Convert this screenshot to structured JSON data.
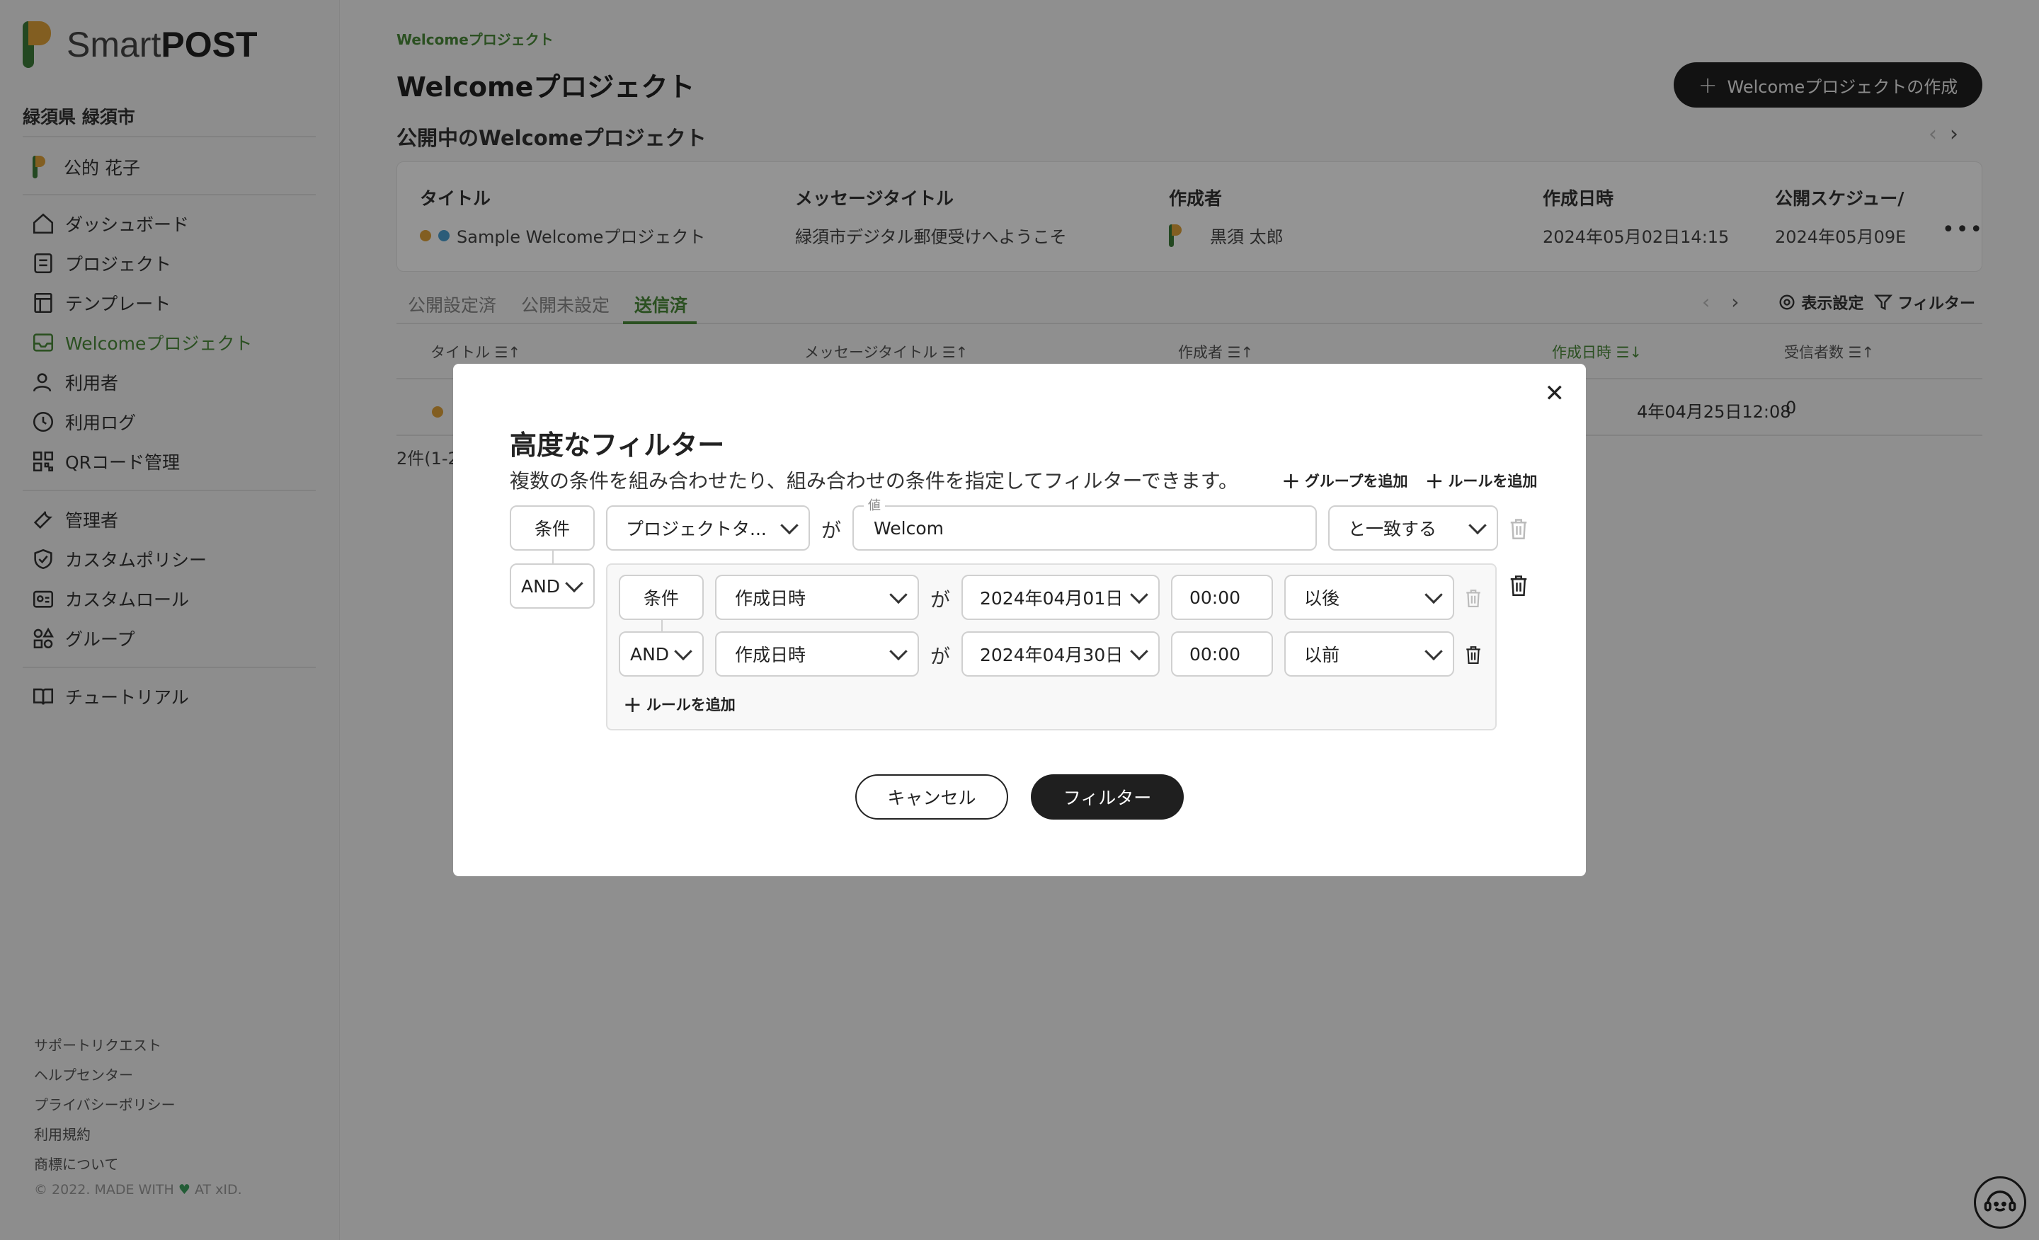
{
  "app": {
    "logo_light": "Smart",
    "logo_bold": "POST",
    "colors": {
      "accent": "#4a8a3a",
      "logo_green": "#3d7d3a",
      "logo_orange": "#e0a23a",
      "dark": "#1f1f1f"
    }
  },
  "sidebar": {
    "org": "緑須県 緑須市",
    "user": "公的 花子",
    "nav": [
      {
        "label": "ダッシュボード",
        "icon": "home-icon"
      },
      {
        "label": "プロジェクト",
        "icon": "project-icon"
      },
      {
        "label": "テンプレート",
        "icon": "template-icon"
      },
      {
        "label": "Welcomeプロジェクト",
        "icon": "welcome-icon",
        "active": true
      },
      {
        "label": "利用者",
        "icon": "user-icon"
      },
      {
        "label": "利用ログ",
        "icon": "log-icon"
      },
      {
        "label": "QRコード管理",
        "icon": "qr-icon"
      },
      {
        "label": "管理者",
        "icon": "admin-icon"
      },
      {
        "label": "カスタムポリシー",
        "icon": "shield-icon"
      },
      {
        "label": "カスタムロール",
        "icon": "role-icon"
      },
      {
        "label": "グループ",
        "icon": "group-icon"
      },
      {
        "label": "チュートリアル",
        "icon": "book-icon"
      }
    ],
    "footer": [
      "サポートリクエスト",
      "ヘルプセンター",
      "プライバシーポリシー",
      "利用規約",
      "商標について"
    ],
    "copyright_pre": "© 2022. MADE WITH",
    "copyright_post": "AT xID."
  },
  "main": {
    "breadcrumb": "Welcomeプロジェクト",
    "title": "Welcomeプロジェクト",
    "create_button": "Welcomeプロジェクトの作成",
    "published_title": "公開中のWelcomeプロジェクト",
    "published_card": {
      "headers": [
        "タイトル",
        "メッセージタイトル",
        "作成者",
        "作成日時",
        "公開スケジュー/"
      ],
      "title": "Sample Welcomeプロジェクト",
      "message_title": "緑須市デジタル郵便受けへようこそ",
      "creator": "黒須 太郎",
      "created_at": "2024年05月02日14:15",
      "schedule": "2024年05月09E"
    },
    "tabs": [
      "公開設定済",
      "公開未設定",
      "送信済"
    ],
    "active_tab": "送信済",
    "tools": {
      "display_settings": "表示設定",
      "filter": "フィルター"
    },
    "table_headers": [
      "タイトル",
      "メッセージタイトル",
      "作成者",
      "作成日時",
      "受信者数"
    ],
    "table_row": {
      "created_at": "4年04月25日12:08",
      "recipients": "0"
    },
    "count_text": "2件(1-2"
  },
  "modal": {
    "title": "高度なフィルター",
    "description": "複数の条件を組み合わせたり、組み合わせの条件を指定してフィルターできます。",
    "add_group": "グループを追加",
    "add_rule": "ルールを追加",
    "condition_label": "条件",
    "ga": "が",
    "rule1": {
      "field": "プロジェクトタ...",
      "value_label": "値",
      "value": "Welcom",
      "operator": "と一致する"
    },
    "group_operator": "AND",
    "group": {
      "rule1": {
        "field": "作成日時",
        "date": "2024年04月01日",
        "time": "00:00",
        "operator": "以後"
      },
      "operator": "AND",
      "rule2": {
        "field": "作成日時",
        "date": "2024年04月30日",
        "time": "00:00",
        "operator": "以前"
      },
      "add_rule": "ルールを追加"
    },
    "cancel": "キャンセル",
    "submit": "フィルター"
  }
}
